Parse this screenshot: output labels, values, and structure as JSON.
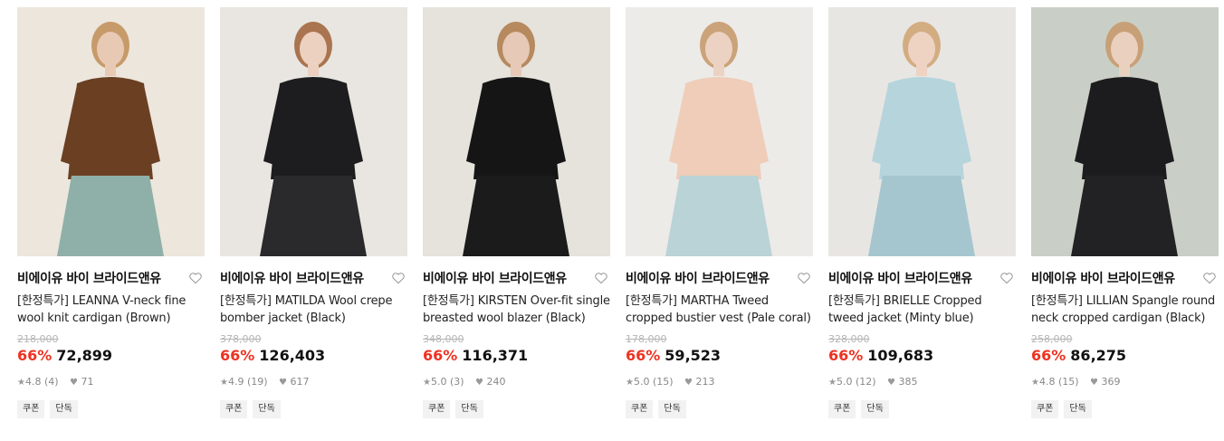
{
  "products": [
    {
      "brand": "비에이유 바이 브라이드앤유",
      "title": "[한정특가] LEANNA V-neck fine wool knit cardigan (Brown)",
      "original_price": "218,000",
      "discount": "66%",
      "price": "72,899",
      "rating": "4.8 (4)",
      "likes": "71",
      "badges": [
        "쿠폰",
        "단독"
      ],
      "image": {
        "bg": "#ece6dd",
        "main": "#6b3f22",
        "skirt": "#8fb0a8",
        "skin": "#e8c9b4",
        "hair": "#c79a6a"
      }
    },
    {
      "brand": "비에이유 바이 브라이드앤유",
      "title": "[한정특가] MATILDA Wool crepe bomber jacket (Black)",
      "original_price": "378,000",
      "discount": "66%",
      "price": "126,403",
      "rating": "4.9 (19)",
      "likes": "617",
      "badges": [
        "쿠폰",
        "단독"
      ],
      "image": {
        "bg": "#e9e6e1",
        "main": "#1d1d1f",
        "skirt": "#2a2a2c",
        "skin": "#ecd0c0",
        "hair": "#a9744f"
      }
    },
    {
      "brand": "비에이유 바이 브라이드앤유",
      "title": "[한정특가] KIRSTEN Over-fit single breasted wool blazer (Black)",
      "original_price": "348,000",
      "discount": "66%",
      "price": "116,371",
      "rating": "5.0 (3)",
      "likes": "240",
      "badges": [
        "쿠폰",
        "단독"
      ],
      "image": {
        "bg": "#e6e2dc",
        "main": "#151515",
        "skirt": "#1b1b1b",
        "skin": "#e6c9b6",
        "hair": "#b68a5e"
      }
    },
    {
      "brand": "비에이유 바이 브라이드앤유",
      "title": "[한정특가] MARTHA Tweed cropped bustier vest (Pale coral)",
      "original_price": "178,000",
      "discount": "66%",
      "price": "59,523",
      "rating": "5.0 (15)",
      "likes": "213",
      "badges": [
        "쿠폰",
        "단독"
      ],
      "image": {
        "bg": "#ecebe8",
        "main": "#efcdb8",
        "skirt": "#b9d3d6",
        "skin": "#ecd2c2",
        "hair": "#caa37a"
      }
    },
    {
      "brand": "비에이유 바이 브라이드앤유",
      "title": "[한정특가] BRIELLE Cropped tweed jacket (Minty blue)",
      "original_price": "328,000",
      "discount": "66%",
      "price": "109,683",
      "rating": "5.0 (12)",
      "likes": "385",
      "badges": [
        "쿠폰",
        "단독"
      ],
      "image": {
        "bg": "#e8e6e3",
        "main": "#b6d4dc",
        "skirt": "#a6c6cf",
        "skin": "#eed3c3",
        "hair": "#d3ad82"
      }
    },
    {
      "brand": "비에이유 바이 브라이드앤유",
      "title": "[한정특가] LILLIAN Spangle round neck cropped cardigan (Black)",
      "original_price": "258,000",
      "discount": "66%",
      "price": "86,275",
      "rating": "4.8 (15)",
      "likes": "369",
      "badges": [
        "쿠폰",
        "단독"
      ],
      "image": {
        "bg": "#c9cfc6",
        "main": "#1c1c1e",
        "skirt": "#222224",
        "skin": "#ead0bf",
        "hair": "#c8a077"
      }
    }
  ]
}
